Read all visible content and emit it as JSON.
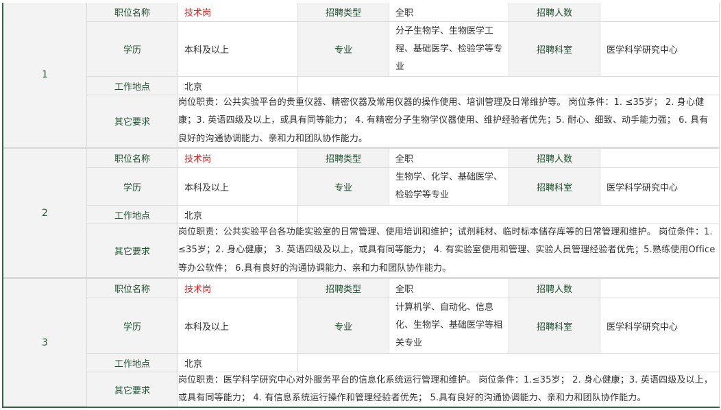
{
  "labels": {
    "position_name": "职位名称",
    "recruit_type": "招聘类型",
    "recruit_count": "招聘人数",
    "education": "学 历",
    "major": "专 业",
    "department": "招聘科室",
    "work_location": "工作地点",
    "other_requirements": "其它要求"
  },
  "positions": [
    {
      "index": "1",
      "position_name": "技术岗",
      "recruit_type": "全职",
      "recruit_count": "",
      "education": "本科及以上",
      "major": "分子生物学、生物医学工程、基础医学、检验学等专业",
      "department": "医学科学研究中心",
      "work_location": "北京",
      "other_requirements": "岗位职责：公共实验平台的贵重仪器、精密仪器及常用仪器的操作使用、培训管理及日常维护等。 岗位条件：1. ≤35岁； 2. 身心健康；3. 英语四级及以上，或具有同等能力； 4. 有精密分子生物学仪器使用、维护经验者优先；5. 耐心、细致、动手能力强； 6. 具有良好的沟通协调能力、亲和力和团队协作能力。"
    },
    {
      "index": "2",
      "position_name": "技术岗",
      "recruit_type": "全职",
      "recruit_count": "",
      "education": "本科及以上",
      "major": "生物学、化学、基础医学、检验学等专业",
      "department": "医学科学研究中心",
      "work_location": "北京",
      "other_requirements": "岗位职责：公共实验平台各功能实验室的日常管理、使用培训和维护；试剂耗材、临时标本储存库等的日常管理和维护。 岗位条件：1. ≤35岁；2. 身心健康； 3. 英语四级及以上，或具有同等能力； 4. 有实验室使用和管理、实验人员管理经验者优先；5.熟练使用Office等办公软件； 6.具有良好的沟通协调能力、亲和力和团队协作能力。"
    },
    {
      "index": "3",
      "position_name": "技术岗",
      "recruit_type": "全职",
      "recruit_count": "",
      "education": "本科及以上",
      "major": "计算机学、自动化、信息化、生物学、基础医学等相关专业",
      "department": "医学科学研究中心",
      "work_location": "北京",
      "other_requirements": "岗位职责：医学科学研究中心对外服务平台的信息化系统运行管理和维护。 岗位条件：1.≤35岁； 2. 身心健康；3. 英语四级及以上，或具有同等能力； 4. 有信息系统运行操作和管理经验者优先； 5.具有良好的沟通协调能力、亲和力和团队协作能力。"
    }
  ]
}
